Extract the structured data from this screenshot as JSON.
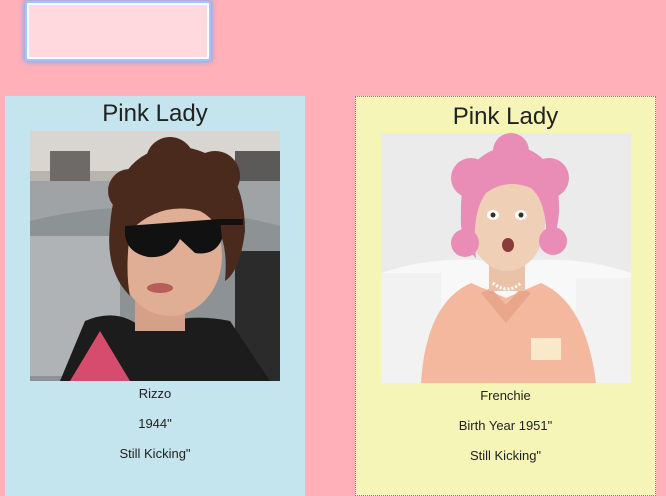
{
  "search": {
    "value": ""
  },
  "cards": [
    {
      "title": "Pink Lady",
      "photo_subject": "woman with dark curly hair and large black sunglasses in a car",
      "name": "Rizzo",
      "year": "1944\"",
      "status": "Still Kicking\""
    },
    {
      "title": "Pink Lady",
      "photo_subject": "woman with pink curly hair in a peach uniform",
      "name": "Frenchie",
      "year": "Birth Year 1951\"",
      "status": "Still Kicking\""
    }
  ],
  "colors": {
    "page_background": "#ffb0b9",
    "card_rizzo_background": "#c4e4ee",
    "card_frenchie_background": "#f5f5b7",
    "input_background": "#ffd9de",
    "input_focus_ring": "#9fc6f7"
  }
}
